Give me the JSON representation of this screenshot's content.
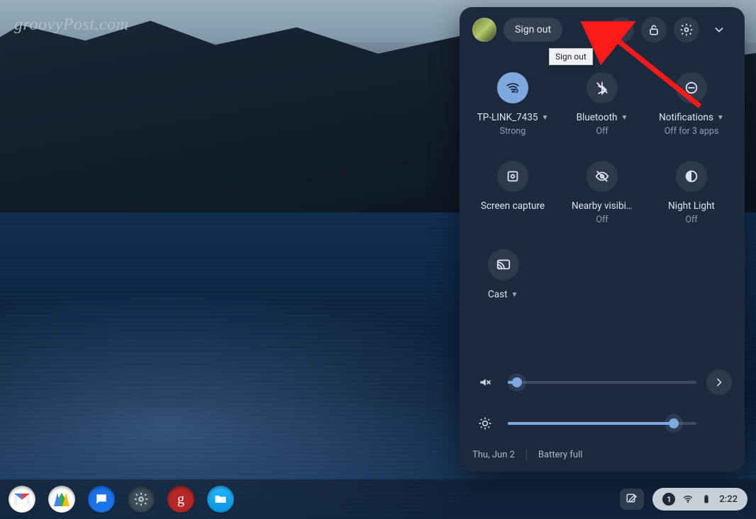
{
  "watermark": "groovyPost.com",
  "panel": {
    "sign_out_label": "Sign out",
    "tooltip": "Sign out",
    "tiles": {
      "wifi": {
        "label": "TP-LINK_7435",
        "sub": "Strong",
        "active": true,
        "has_caret": true
      },
      "bluetooth": {
        "label": "Bluetooth",
        "sub": "Off",
        "active": false,
        "has_caret": true
      },
      "notifications": {
        "label": "Notifications",
        "sub": "Off for 3 apps",
        "active": false,
        "has_caret": true
      },
      "capture": {
        "label": "Screen capture",
        "sub": "",
        "active": false,
        "has_caret": false
      },
      "nearby": {
        "label": "Nearby visibi…",
        "sub": "Off",
        "active": false,
        "has_caret": false
      },
      "night": {
        "label": "Night Light",
        "sub": "Off",
        "active": false,
        "has_caret": false
      },
      "cast": {
        "label": "Cast",
        "sub": "",
        "active": false,
        "has_caret": true
      }
    },
    "volume_percent": 5,
    "brightness_percent": 88,
    "footer": {
      "date": "Thu, Jun 2",
      "battery": "Battery full"
    }
  },
  "shelf": {
    "notification_count": "1",
    "clock": "2:22"
  }
}
